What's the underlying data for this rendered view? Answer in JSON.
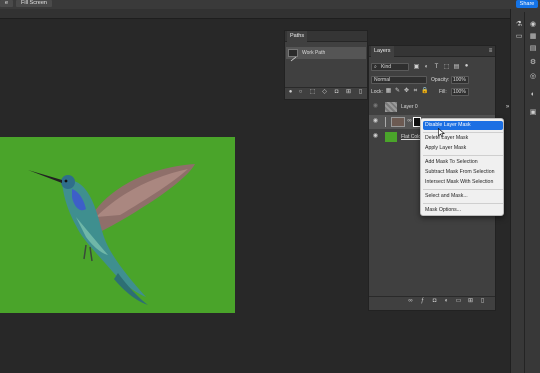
{
  "topbar": {
    "left_button_label": "e",
    "fill_screen_label": "Fill Screen",
    "share_label": "Share"
  },
  "paths_panel": {
    "tab_label": "Paths",
    "items": [
      {
        "label": "Work Path"
      }
    ]
  },
  "layers_panel": {
    "tab_label": "Layers",
    "filter_label": "Kind",
    "blend_mode": "Normal",
    "opacity_label": "Opacity:",
    "opacity_value": "100%",
    "lock_label": "Lock:",
    "fill_label": "Fill:",
    "fill_value": "100%",
    "layers": [
      {
        "name": "Layer 0"
      },
      {
        "name": ""
      },
      {
        "name": "Flat Colo"
      }
    ]
  },
  "context_menu": {
    "items": [
      {
        "label": "Disable Layer Mask",
        "highlighted": true
      },
      {
        "label": "Delete Layer Mask"
      },
      {
        "label": "Apply Layer Mask"
      },
      {
        "label": "Add Mask To Selection"
      },
      {
        "label": "Subtract Mask From Selection"
      },
      {
        "label": "Intersect Mask With Selection"
      },
      {
        "label": "Select and Mask..."
      },
      {
        "label": "Mask Options..."
      }
    ]
  },
  "colors": {
    "canvas_green": "#4aa42a",
    "accent_blue": "#1c6fe3",
    "panel_bg": "#404040"
  },
  "icons": [
    "eye-icon",
    "search-icon",
    "lock-icon",
    "brush-icon",
    "move-icon",
    "fx-icon",
    "mask-icon",
    "folder-icon",
    "trash-icon",
    "link-icon"
  ]
}
